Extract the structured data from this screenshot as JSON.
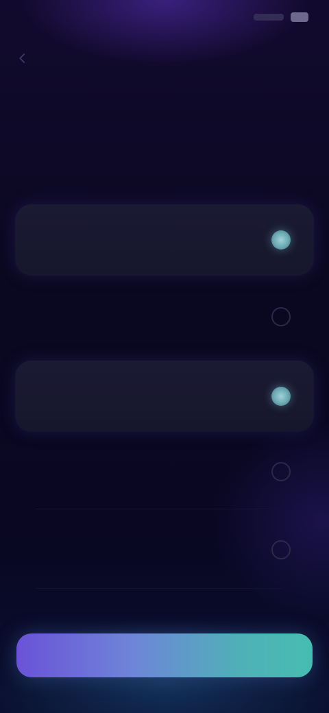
{
  "status_bar": {
    "time": "",
    "signal": "signal-icon",
    "battery": "battery-icon"
  },
  "header": {
    "back_icon": "chevron-left-icon",
    "title": ""
  },
  "intro": {
    "label": "",
    "text": ""
  },
  "options": [
    {
      "label": "",
      "selected": true
    },
    {
      "label": "",
      "selected": false
    },
    {
      "label": "",
      "selected": true
    },
    {
      "label": "",
      "selected": false
    },
    {
      "label": "",
      "selected": false
    }
  ],
  "cta": {
    "label": ""
  },
  "colors": {
    "background": "#0a0820",
    "accent_start": "#6a52d8",
    "accent_end": "#46bdb0",
    "radio_selected": "#7fbcc4"
  }
}
